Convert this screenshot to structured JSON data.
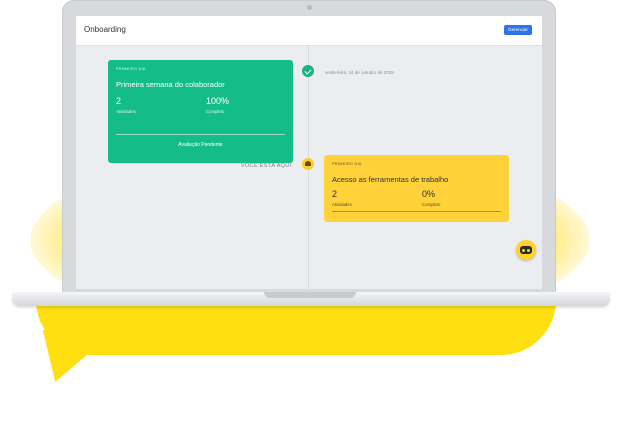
{
  "app": {
    "title": "Onboarding",
    "manage_label": "Gerenciar"
  },
  "timeline": {
    "current_marker_label": "VOCÊ ESTÁ AQUI",
    "items": [
      {
        "tag": "PRIMEIRO DIA",
        "title": "Primeira semana do colaborador",
        "date": "sexta-feira, 24 de outubro de 2025",
        "stats": [
          {
            "value": "2",
            "label": "Atividades"
          },
          {
            "value": "100%",
            "label": "Completo"
          }
        ],
        "footer": "Avaliação Pendente",
        "status": "complete",
        "color": "#14bd86"
      },
      {
        "tag": "PRIMEIRO DIA",
        "title": "Acesso as ferramentas de trabalho",
        "stats": [
          {
            "value": "2",
            "label": "Atividades"
          },
          {
            "value": "0%",
            "label": "Completo"
          }
        ],
        "status": "current",
        "color": "#ffd23a"
      }
    ]
  },
  "icons": {
    "done": "check-circle-icon",
    "current": "bell-icon",
    "assistant": "robot-assistant-icon"
  },
  "colors": {
    "accent": "#2f73e8",
    "brand_yellow": "#ffdf0f",
    "success": "#14bd86"
  }
}
